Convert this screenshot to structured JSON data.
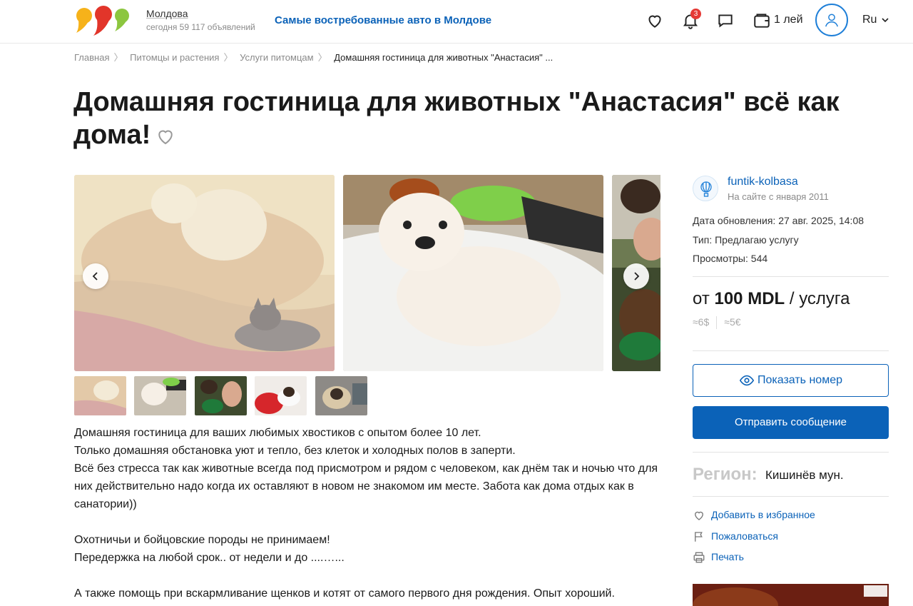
{
  "header": {
    "region_name": "Молдова",
    "region_count": "сегодня 59 117 объявлений",
    "promo_link": "Самые востребованные авто в Молдове",
    "notifications_count": "3",
    "wallet_amount": "1 лей",
    "language": "Ru"
  },
  "breadcrumb": {
    "items": [
      "Главная",
      "Питомцы и растения",
      "Услуги питомцам"
    ],
    "current": "Домашняя гостиница для животных \"Анастасия\" ..."
  },
  "title": "Домашняя гостиница для животных \"Анастасия\" всё как дома!",
  "description": {
    "lines": [
      "Домашняя гостиница для ваших любимых хвостиков с опытом более 10 лет.",
      "Только домашняя обстановка уют и тепло, без клеток и холодных полов в заперти.",
      "Всё без стресса так как животные всегда под присмотром и рядом с человеком, как днём так и ночью что для них действительно надо когда их оставляют в новом не знакомом им  месте. Забота как дома отдых как в санатории))",
      "",
      "Охотничьи и бойцовские породы не принимаем!",
      "Передержка на любой срок.. от недели и до ....…...",
      "",
      "А также помощь при вскармливание щенков и котят от самого первого дня рождения. Опыт хороший."
    ]
  },
  "seller": {
    "name": "funtik-kolbasa",
    "since": "На сайте с января 2011"
  },
  "meta": {
    "updated": "Дата обновления: 27 авг. 2025, 14:08",
    "type": "Тип: Предлагаю услугу",
    "views": "Просмотры: 544"
  },
  "price": {
    "prefix": "от",
    "amount": "100 MDL",
    "unit": "/ услуга",
    "usd": "≈6$",
    "eur": "≈5€"
  },
  "buttons": {
    "show_phone": "Показать номер",
    "send_message": "Отправить сообщение"
  },
  "region": {
    "label": "Регион:",
    "value": "Кишинёв мун."
  },
  "actions": {
    "favorite": "Добавить в избранное",
    "report": "Пожаловаться",
    "print": "Печать"
  },
  "colors": {
    "brand_blue": "#0b62b8",
    "logo_yellow": "#f6b21a",
    "logo_red": "#e2352a",
    "logo_green": "#8cc63f",
    "badge_red": "#e53935"
  },
  "icons": [
    "heart-icon",
    "bell-icon",
    "chat-icon",
    "wallet-icon",
    "user-icon",
    "chevron-down-icon",
    "chevron-left-icon",
    "chevron-right-icon",
    "eye-icon",
    "balloon-icon",
    "flag-icon",
    "print-icon"
  ]
}
